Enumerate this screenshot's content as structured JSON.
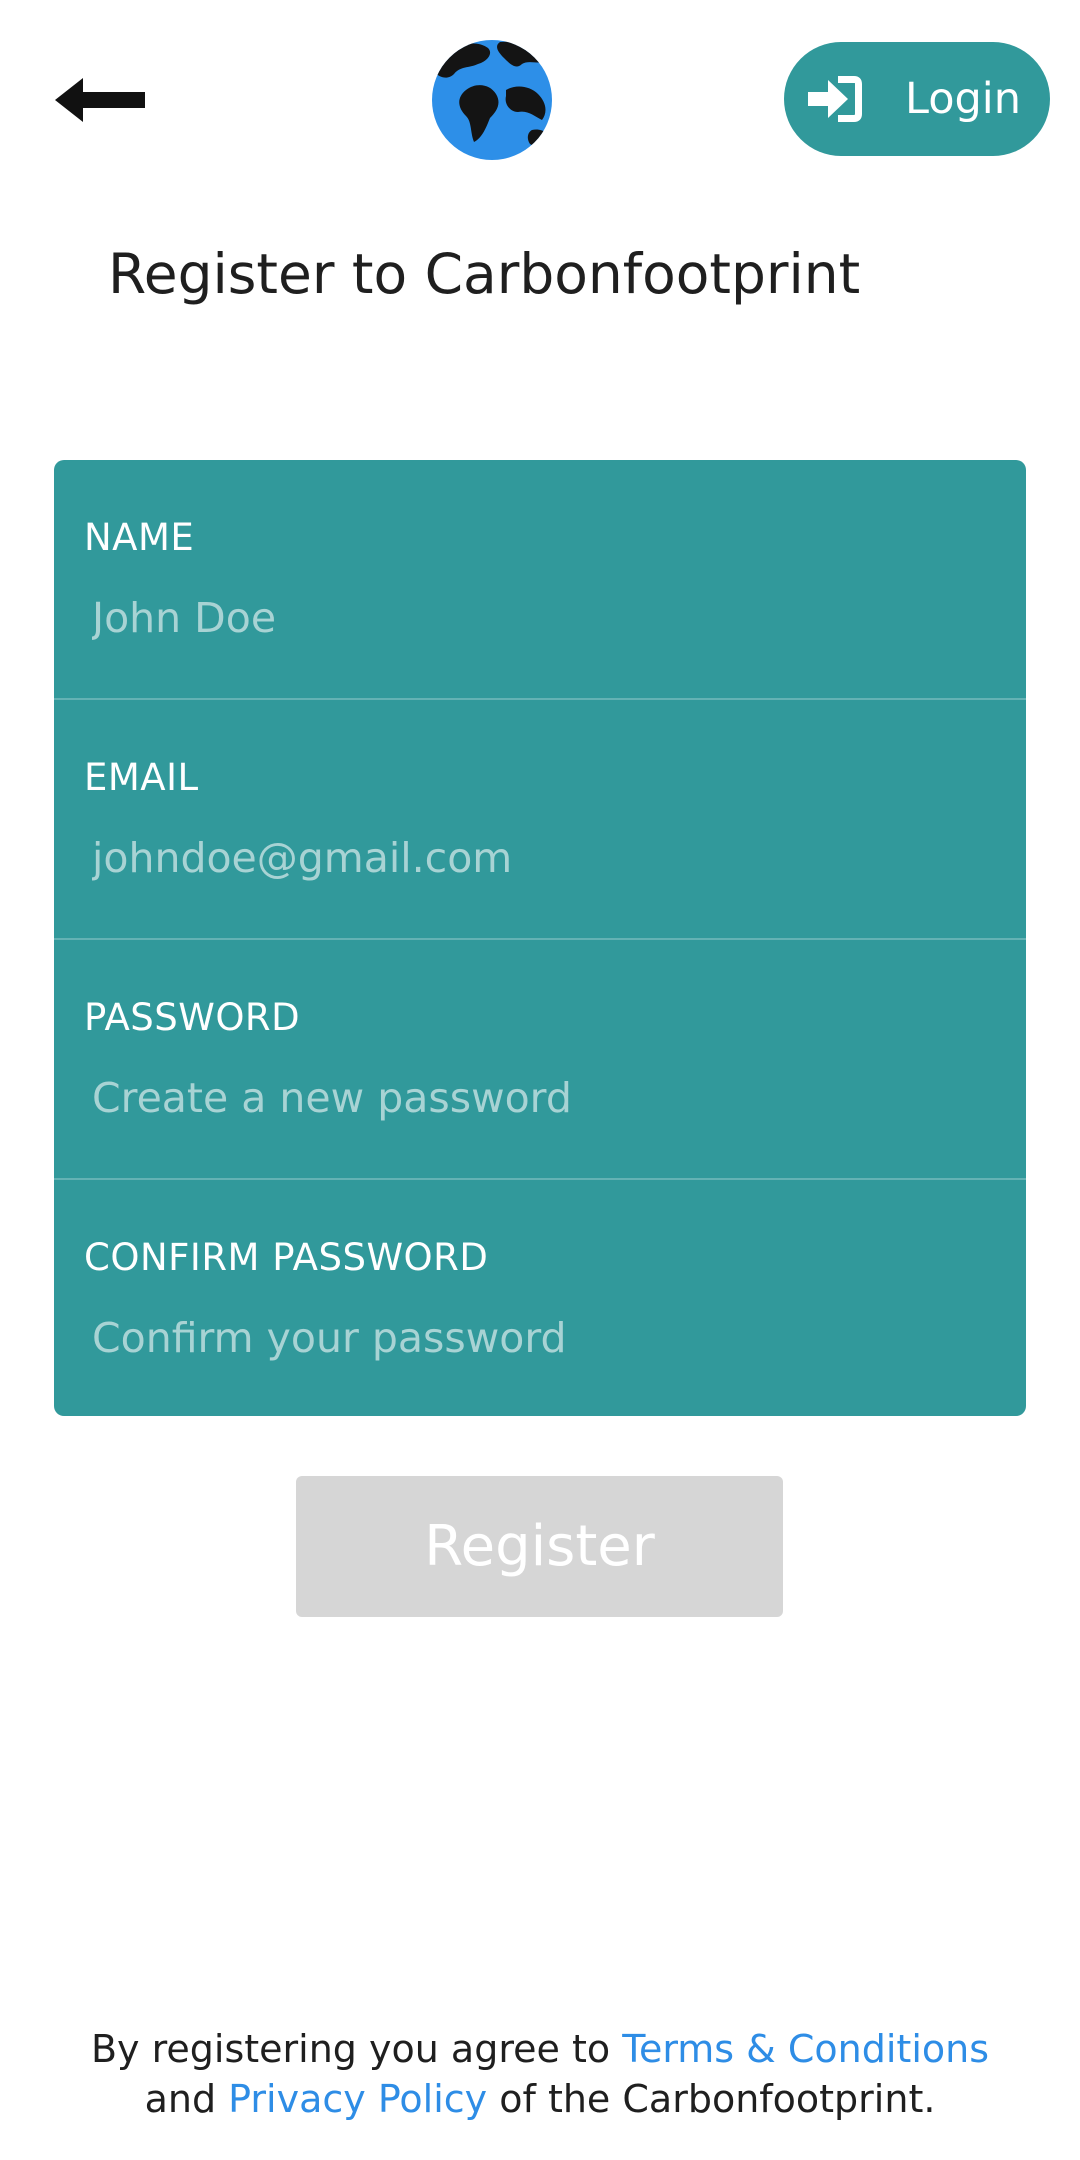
{
  "header": {
    "back_icon": "arrow-left-icon",
    "logo_icon": "globe-icon",
    "login": {
      "icon": "sign-in-icon",
      "label": "Login"
    }
  },
  "page_title": "Register to Carbonfootprint",
  "form": {
    "fields": [
      {
        "label": "NAME",
        "placeholder": "John Doe",
        "value": ""
      },
      {
        "label": "EMAIL",
        "placeholder": "johndoe@gmail.com",
        "value": ""
      },
      {
        "label": "PASSWORD",
        "placeholder": "Create a new password",
        "value": ""
      },
      {
        "label": "CONFIRM PASSWORD",
        "placeholder": "Confirm your password",
        "value": ""
      }
    ],
    "submit_label": "Register"
  },
  "footer": {
    "prefix": "By registering you agree to",
    "terms_link": "Terms & Conditions",
    "middle": "and",
    "privacy_link": "Privacy Policy",
    "suffix": "of the Carbonfootprint."
  },
  "colors": {
    "accent": "#31999b",
    "link": "#2e8de6",
    "disabled_button": "#d6d6d6",
    "globe_ocean": "#2d8fe8",
    "globe_land": "#141414"
  }
}
